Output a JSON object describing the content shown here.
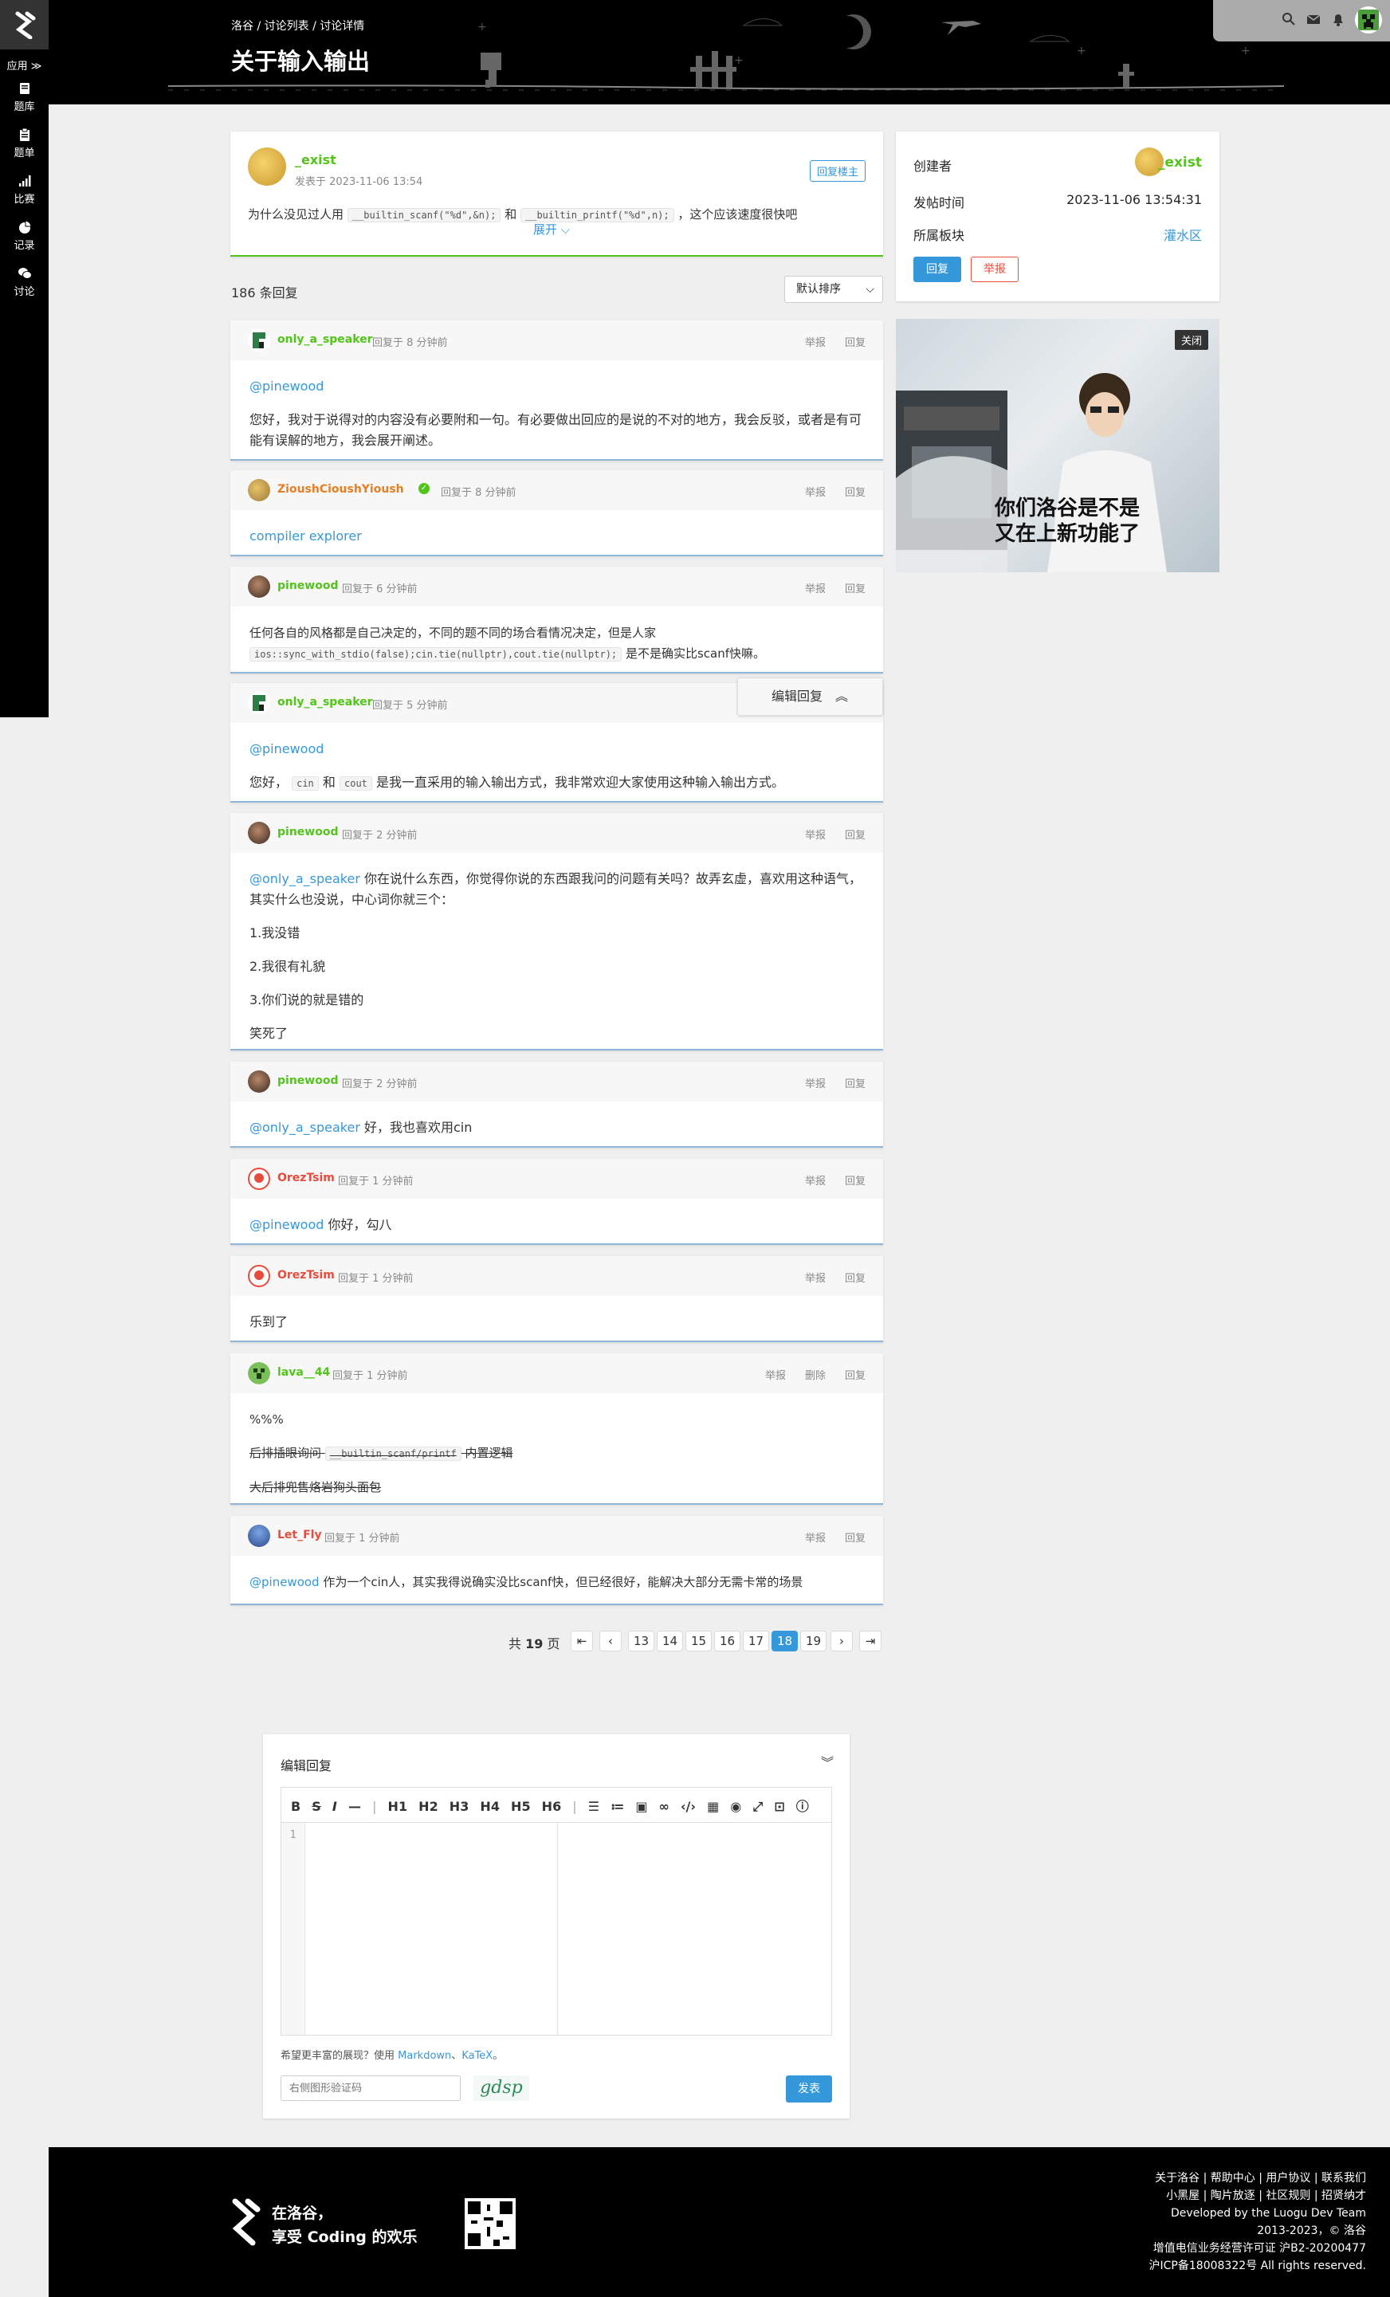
{
  "sidebar": {
    "apps_label": "应用 ≫",
    "items": [
      {
        "label": "题库",
        "icon": "book-icon"
      },
      {
        "label": "题单",
        "icon": "clipboard-icon"
      },
      {
        "label": "比赛",
        "icon": "bar-chart-icon"
      },
      {
        "label": "记录",
        "icon": "pie-chart-icon"
      },
      {
        "label": "讨论",
        "icon": "comments-icon"
      }
    ]
  },
  "header": {
    "breadcrumb": "洛谷 / 讨论列表 / 讨论详情",
    "title": "关于输入输出"
  },
  "post": {
    "author": "_exist",
    "time": "发表于 2023-11-06 13:54",
    "badge": "回复楼主",
    "content_pre": "为什么没见过人用",
    "code1": "__builtin_scanf(\"%d\",&n);",
    "content_mid": "和",
    "code2": "__builtin_printf(\"%d\",n);",
    "content_post": "，这个应该速度很快吧",
    "expand": "展开"
  },
  "reply_count": "186 条回复",
  "sort": "默认排序",
  "info": {
    "creator_label": "创建者",
    "creator": "_exist",
    "time_label": "发帖时间",
    "time": "2023-11-06 13:54:31",
    "board_label": "所属板块",
    "board": "灌水区",
    "reply_btn": "回复",
    "report_btn": "举报"
  },
  "ad": {
    "close": "关闭",
    "text1": "你们洛谷是不是",
    "text2": "又在上新功能了"
  },
  "edit_float": "编辑回复",
  "replies": [
    {
      "user": "only_a_speaker",
      "time": "回复于 8 分钟前",
      "mention": "@pinewood",
      "text": "您好，我对于说得对的内容没有必要附和一句。有必要做出回应的是说的不对的地方，我会反驳，或者是有可能有误解的地方，我会展开阐述。"
    },
    {
      "user": "ZioushCioushYioush",
      "time": "回复于 8 分钟前",
      "link": "compiler explorer"
    },
    {
      "user": "pinewood",
      "time": "回复于 6 分钟前",
      "text1": "任何各自的风格都是自己决定的，不同的题不同的场合看情况决定，但是人家",
      "code": "ios::sync_with_stdio(false);cin.tie(nullptr),cout.tie(nullptr);",
      "text2": "是不是确实比scanf快嘛。"
    },
    {
      "user": "only_a_speaker",
      "time": "回复于 5 分钟前",
      "mention": "@pinewood",
      "pre": "您好，",
      "c1": "cin",
      "and": "和",
      "c2": "cout",
      "post": "是我一直采用的输入输出方式，我非常欢迎大家使用这种输入输出方式。"
    },
    {
      "user": "pinewood",
      "time": "回复于 2 分钟前",
      "mention": "@only_a_speaker",
      "text": "你在说什么东西，你觉得你说的东西跟我问的问题有关吗？故弄玄虚，喜欢用这种语气，其实什么也没说，中心词你就三个：",
      "l1": "1.我没错",
      "l2": "2.我很有礼貌",
      "l3": "3.你们说的就是错的",
      "l4": "笑死了"
    },
    {
      "user": "pinewood",
      "time": "回复于 2 分钟前",
      "mention": "@only_a_speaker",
      "text": "好，我也喜欢用cin"
    },
    {
      "user": "OrezTsim",
      "time": "回复于 1 分钟前",
      "mention": "@pinewood",
      "text": "你好，勾八"
    },
    {
      "user": "OrezTsim",
      "time": "回复于 1 分钟前",
      "text": "乐到了"
    },
    {
      "user": "lava__44",
      "time": "回复于 1 分钟前",
      "l1": "%%%",
      "s1": "后排插眼询问",
      "code": "__builtin_scanf/printf",
      "s1b": "内置逻辑",
      "s2": "大后排兜售烙岩狗头面包"
    },
    {
      "user": "Let_Fly",
      "time": "回复于 1 分钟前",
      "mention": "@pinewood",
      "text": "作为一个cin人，其实我得说确实没比scanf快，但已经很好，能解决大部分无需卡常的场景"
    }
  ],
  "actions": {
    "report": "举报",
    "reply": "回复",
    "delete": "删除"
  },
  "pagination": {
    "total_pre": "共",
    "total": "19",
    "total_post": "页",
    "pages": [
      "13",
      "14",
      "15",
      "16",
      "17",
      "18",
      "19"
    ],
    "current": "18"
  },
  "editor": {
    "title": "编辑回复",
    "line_no": "1",
    "toolbar": [
      "B",
      "S",
      "I",
      "—",
      "|",
      "H1",
      "H2",
      "H3",
      "H4",
      "H5",
      "H6",
      "|"
    ],
    "hint_pre": "希望更丰富的展现？使用",
    "markdown": "Markdown",
    "sep": "、",
    "katex": "KaTeX",
    "hint_post": "。",
    "captcha_placeholder": "右侧图形验证码",
    "captcha": "gdsp",
    "submit": "发表"
  },
  "footer": {
    "slogan1": "在洛谷，",
    "slogan2": "享受 Coding 的欢乐",
    "links1": "关于洛谷 | 帮助中心 | 用户协议 | 联系我们",
    "links2": "小黑屋 | 陶片放逐 | 社区规则 | 招贤纳才",
    "dev": "Developed by the Luogu Dev Team",
    "copy": "2013-2023，© 洛谷",
    "icp1": "增值电信业务经营许可证 沪B2-20200477",
    "icp2": "沪ICP备18008322号 All rights reserved."
  }
}
